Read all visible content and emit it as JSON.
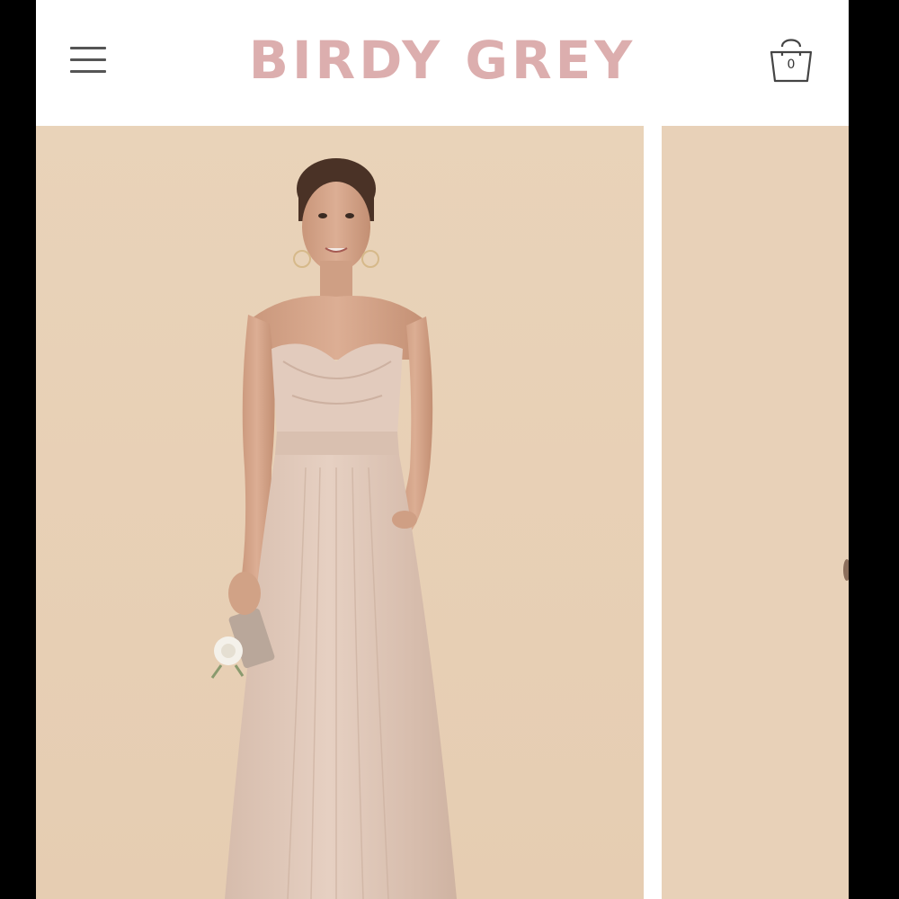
{
  "header": {
    "brand": "BIRDY GREY",
    "cart_count": "0"
  },
  "icons": {
    "menu": "hamburger-menu-icon",
    "cart": "shopping-bag-icon"
  },
  "colors": {
    "brand": "#dcaeae",
    "backdrop": "#e8d3ba",
    "dress": "#e0c8b8",
    "icon_stroke": "#444444"
  },
  "gallery": {
    "slides": [
      {
        "label": "product-photo-1"
      },
      {
        "label": "product-photo-2"
      }
    ]
  }
}
